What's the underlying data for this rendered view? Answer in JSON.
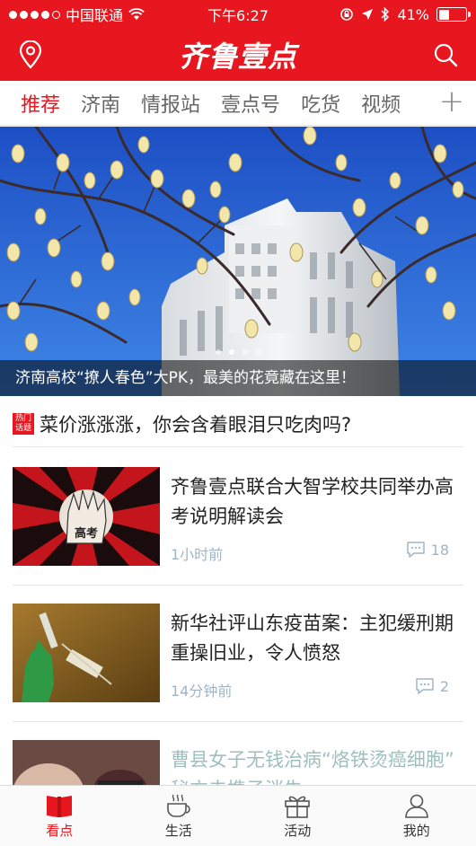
{
  "status_bar": {
    "carrier": "中国联通",
    "time": "下午6:27",
    "battery": "41%",
    "signal_bars": 4,
    "battery_level": 0.41
  },
  "header": {
    "logo": "齐鲁壹点",
    "left_icon": "location-icon",
    "right_icon": "search-icon",
    "brand_color": "#e8161e"
  },
  "tabs": {
    "items": [
      {
        "label": "推荐",
        "active": true
      },
      {
        "label": "济南",
        "active": false
      },
      {
        "label": "情报站",
        "active": false
      },
      {
        "label": "壹点号",
        "active": false
      },
      {
        "label": "吃货",
        "active": false
      },
      {
        "label": "视频",
        "active": false
      }
    ],
    "add_label": "+"
  },
  "hero": {
    "caption": "济南高校“撩人春色”大PK，最美的花竟藏在这里！",
    "dot_count": 4,
    "active_dot": 1
  },
  "hot_topic": {
    "badge_line1": "热门",
    "badge_line2": "话题",
    "title": "菜价涨涨涨，你会含着眼泪只吃肉吗?"
  },
  "news": [
    {
      "title": "齐鲁壹点联合大智学校共同举办高考说明解读会",
      "time": "1小时前",
      "comments": "18",
      "thumb_text": "高考"
    },
    {
      "title": "新华社评山东疫苗案：主犯缓刑期重操旧业，令人愤怒",
      "time": "14分钟前",
      "comments": "2"
    },
    {
      "title": "曹县女子无钱治病“烙铁烫癌细胞” 秘方未携子消失",
      "time": "",
      "comments": ""
    }
  ],
  "bottom_nav": [
    {
      "label": "看点",
      "icon": "book-icon",
      "active": true
    },
    {
      "label": "生活",
      "icon": "coffee-icon",
      "active": false
    },
    {
      "label": "活动",
      "icon": "gift-icon",
      "active": false
    },
    {
      "label": "我的",
      "icon": "user-icon",
      "active": false
    }
  ]
}
